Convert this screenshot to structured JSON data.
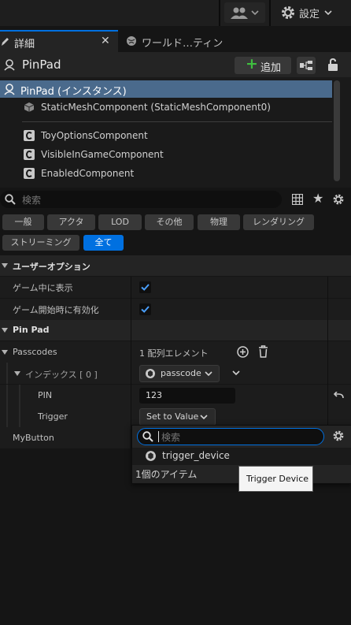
{
  "topbar": {
    "settings_label": "設定"
  },
  "tabs": [
    {
      "label": "詳細",
      "active": true
    },
    {
      "label": "ワールド…ティング",
      "active": false
    }
  ],
  "actor": {
    "name": "PinPad",
    "add_label": "追加"
  },
  "components": [
    {
      "label": "PinPad (インスタンス)",
      "selected": true,
      "icon": "actor-icon"
    },
    {
      "label": "StaticMeshComponent (StaticMeshComponent0)",
      "icon": "static-mesh-icon"
    },
    {
      "label": "ToyOptionsComponent",
      "icon": "component-c-icon"
    },
    {
      "label": "VisibleInGameComponent",
      "icon": "component-c-icon"
    },
    {
      "label": "EnabledComponent",
      "icon": "component-c-icon"
    }
  ],
  "search": {
    "placeholder": "検索"
  },
  "filters": {
    "row1": [
      "一般",
      "アクタ",
      "LOD",
      "その他",
      "物理",
      "レンダリング"
    ],
    "row2": [
      "ストリーミング",
      "全て"
    ],
    "active": "全て"
  },
  "sections": {
    "user_options": {
      "title": "ユーザーオプション",
      "show_in_game_label": "ゲーム中に表示",
      "enabled_at_start_label": "ゲーム開始時に有効化"
    },
    "pinpad": {
      "title": "Pin Pad",
      "passcodes_label": "Passcodes",
      "passcodes_value": "1 配列エレメント",
      "index_label": "インデックス [ 0 ]",
      "index_type": "passcode",
      "pin_label": "PIN",
      "pin_value": "123",
      "trigger_label": "Trigger",
      "trigger_value": "Set to Value",
      "mybutton_label": "MyButton"
    }
  },
  "popup": {
    "search_placeholder": "検索",
    "item_label": "trigger_device",
    "count_label": "1個のアイテム",
    "tooltip": "Trigger Device"
  },
  "colors": {
    "accent": "#0070e0",
    "selection": "#4a6a8c",
    "background": "#151515",
    "add_green": "#3fbf3f"
  }
}
